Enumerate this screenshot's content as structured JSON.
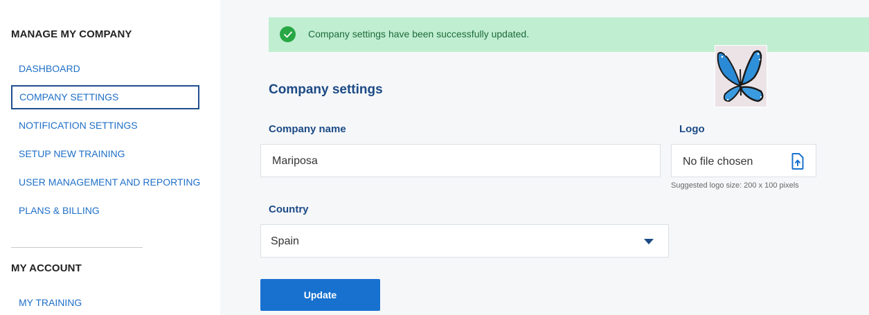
{
  "sidebar": {
    "manage_title": "MANAGE MY COMPANY",
    "items": [
      {
        "label": "DASHBOARD"
      },
      {
        "label": "COMPANY SETTINGS"
      },
      {
        "label": "NOTIFICATION SETTINGS"
      },
      {
        "label": "SETUP NEW TRAINING"
      },
      {
        "label": "USER MANAGEMENT AND REPORTING"
      },
      {
        "label": "PLANS & BILLING"
      }
    ],
    "account_title": "MY ACCOUNT",
    "account_items": [
      {
        "label": "MY TRAINING"
      }
    ]
  },
  "alert": {
    "message": "Company settings have been successfully updated.",
    "icon": "check-circle-icon"
  },
  "form": {
    "title": "Company settings",
    "company_name_label": "Company name",
    "company_name_value": "Mariposa",
    "logo_label": "Logo",
    "logo_file_text": "No file chosen",
    "logo_hint": "Suggested logo size: 200 x 100 pixels",
    "country_label": "Country",
    "country_value": "Spain",
    "update_label": "Update"
  },
  "colors": {
    "accent": "#1871cf",
    "heading": "#1b4a85",
    "link": "#1e6fc7",
    "success_bg": "#c0eed1",
    "success_icon": "#28a745"
  }
}
